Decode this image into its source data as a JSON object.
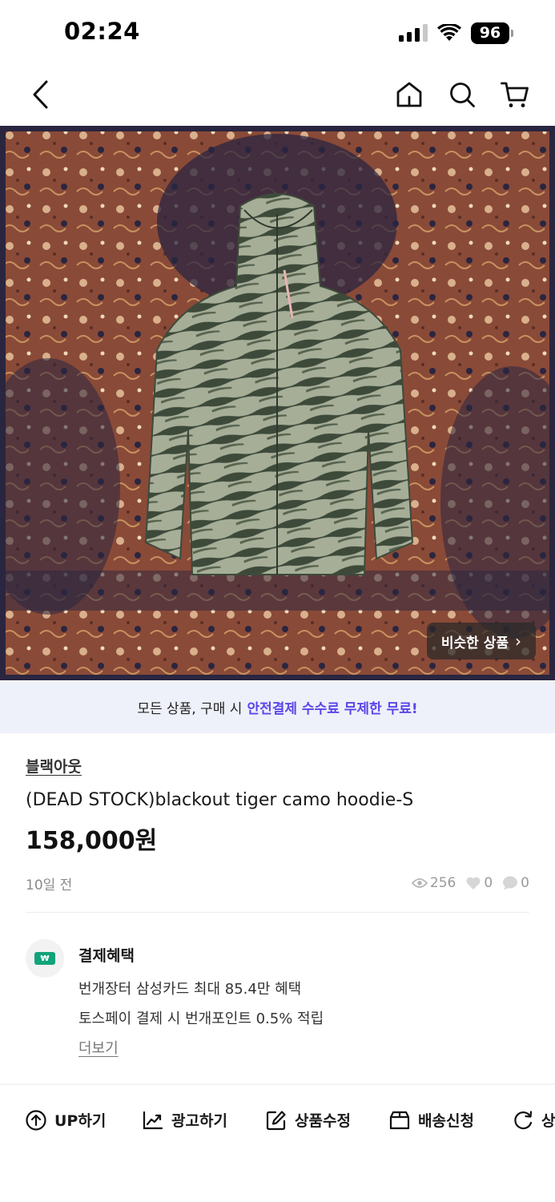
{
  "status_bar": {
    "time": "02:24",
    "battery": "96"
  },
  "nav": {
    "icons": [
      "back-icon",
      "home-icon",
      "search-icon",
      "cart-icon"
    ]
  },
  "image": {
    "similar_button_label": "비슷한 상품",
    "colors": {
      "rug": "#8a4a38",
      "rug_dark": "#2a2640",
      "hoodie_light": "#9aa38f",
      "hoodie_dark": "#3d4a3a"
    }
  },
  "promo": {
    "text": "모든 상품, 구매 시",
    "highlight": "안전결제 수수료 무제한 무료!",
    "highlight_color": "#5b46e8"
  },
  "product": {
    "store": "블랙아웃",
    "title": "(DEAD STOCK)blackout tiger camo hoodie-S",
    "price": "158,000원",
    "posted": "10일 전",
    "views": "256",
    "likes": "0",
    "chats": "0"
  },
  "benefits": {
    "icon_label": "₩",
    "title": "결제혜택",
    "line1": "번개장터 삼성카드 최대 85.4만 혜택",
    "line2": "토스페이 결제 시 번개포인트 0.5% 적립",
    "more": "더보기"
  },
  "actions": {
    "up": "UP하기",
    "ad": "광고하기",
    "edit": "상품수정",
    "shipping": "배송신청",
    "refresh": "상"
  }
}
